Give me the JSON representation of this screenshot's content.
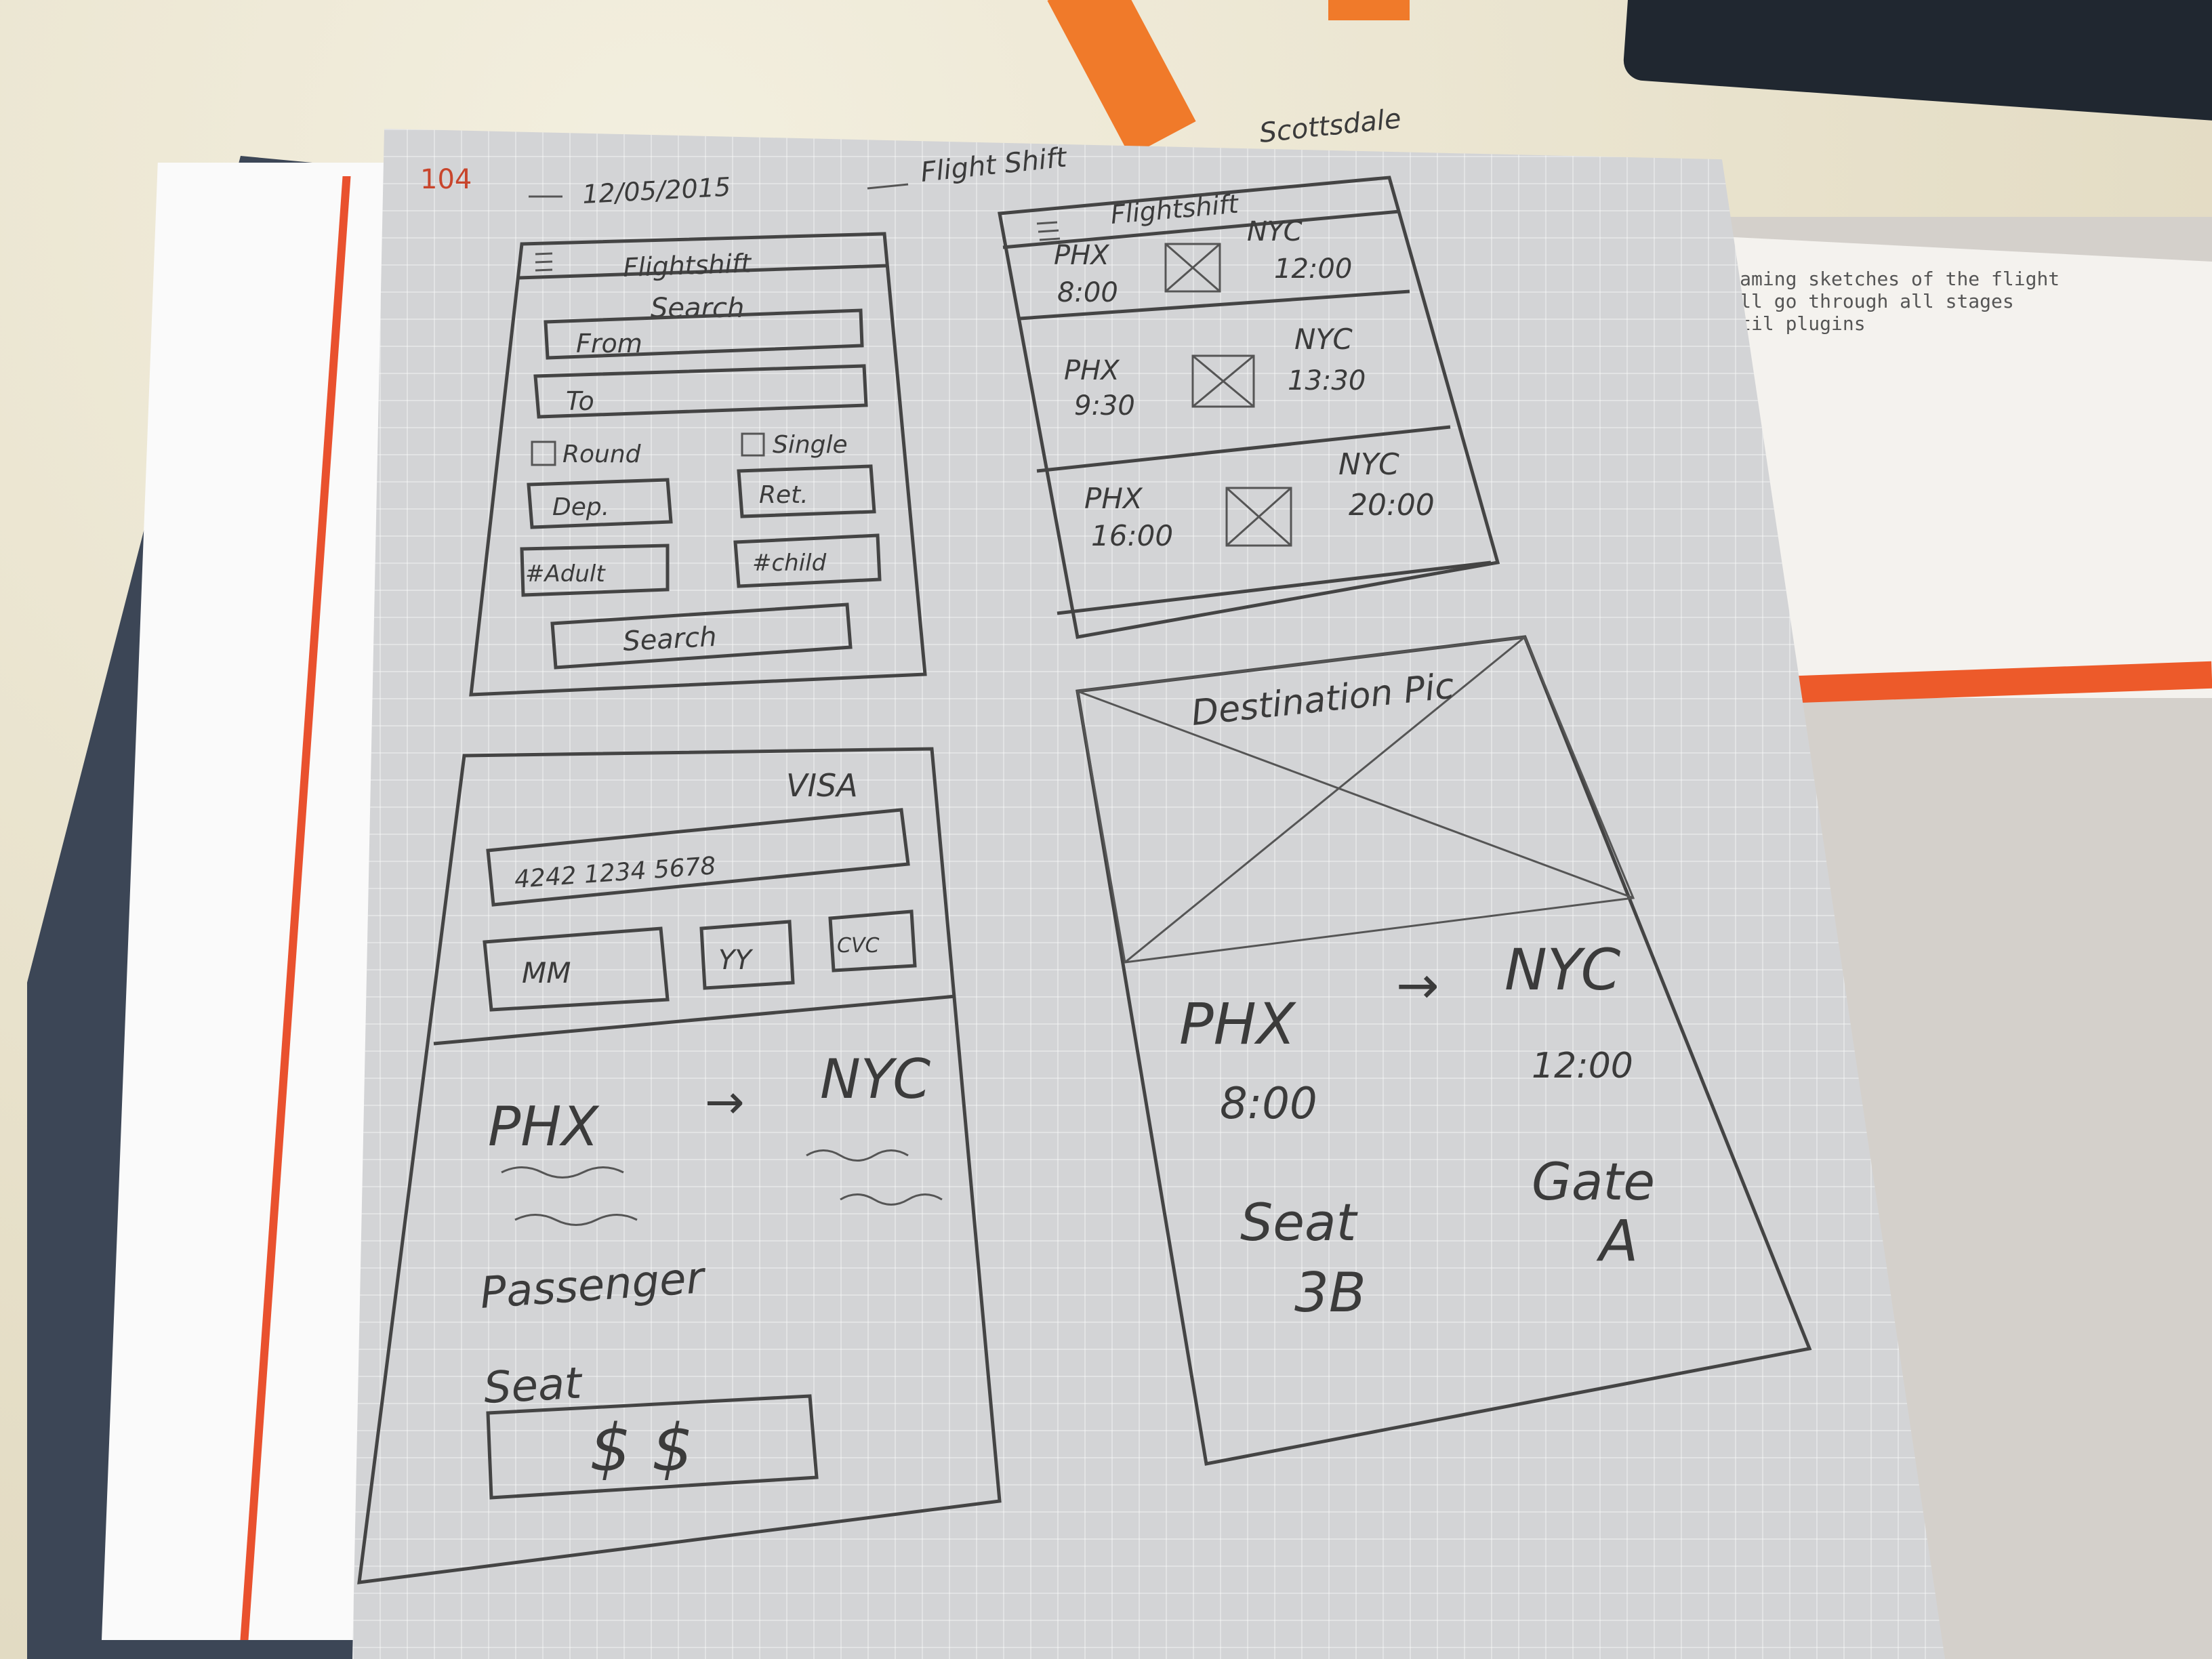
{
  "header": {
    "page_number": "104",
    "date": "12/05/2015",
    "project": "Flight Shift",
    "location": "Scottsdale"
  },
  "right_page_notes": {
    "title": "Flight Shift",
    "lines": [
      "These are the wireframing sketches of the flight",
      "application. They will go through all stages",
      "the flight search until plugins"
    ]
  },
  "search_screen": {
    "app_title": "Flightshift",
    "heading": "Search",
    "from_placeholder": "From",
    "to_placeholder": "To",
    "round_label": "Round",
    "single_label": "Single",
    "departure_label": "Dep.",
    "return_label": "Ret.",
    "adult_label": "#Adult",
    "child_label": "#child",
    "search_button": "Search"
  },
  "results_screen": {
    "app_title": "Flightshift",
    "flights": [
      {
        "from": "PHX",
        "to": "NYC",
        "depart": "8:00",
        "arrive": "12:00"
      },
      {
        "from": "PHX",
        "to": "NYC",
        "depart": "9:30",
        "arrive": "13:30"
      },
      {
        "from": "PHX",
        "to": "NYC",
        "depart": "16:00",
        "arrive": "20:00"
      }
    ]
  },
  "payment_screen": {
    "card_brand": "VISA",
    "card_number": "4242 1234 5678",
    "month_placeholder": "MM",
    "year_placeholder": "YY",
    "cvc_placeholder": "CVC",
    "route_from": "PHX",
    "route_to": "NYC",
    "arrow": "→",
    "passenger_label": "Passenger",
    "seat_label": "Seat",
    "pay_button": "$ $"
  },
  "ticket_screen": {
    "image_label": "Destination Pic",
    "route_from": "PHX",
    "route_to": "NYC",
    "arrow": "→",
    "depart": "8:00",
    "arrive": "12:00",
    "seat_label": "Seat",
    "seat_value": "3B",
    "gate_label": "Gate",
    "gate_value": "A"
  }
}
